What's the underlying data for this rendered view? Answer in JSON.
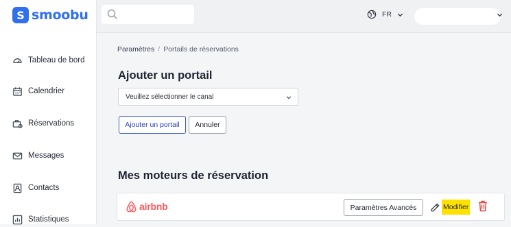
{
  "brand": {
    "name": "smoobu",
    "mark": "S",
    "color": "#2f6ff0"
  },
  "sidebar": {
    "items": [
      {
        "label": "Tableau de bord",
        "icon": "dashboard-icon"
      },
      {
        "label": "Calendrier",
        "icon": "calendar-icon"
      },
      {
        "label": "Réservations",
        "icon": "reservations-icon"
      },
      {
        "label": "Messages",
        "icon": "mail-icon"
      },
      {
        "label": "Contacts",
        "icon": "contacts-icon"
      },
      {
        "label": "Statistiques",
        "icon": "statistics-icon"
      }
    ]
  },
  "topbar": {
    "language": "FR",
    "language_icon": "globe-icon"
  },
  "breadcrumb": {
    "parent": "Paramètres",
    "separator": "/",
    "current": "Portails de réservations"
  },
  "add_portal": {
    "title": "Ajouter un portail",
    "select_value": "Veuillez sélectionner le canal",
    "add_button": "Ajouter un portail",
    "cancel_button": "Annuler"
  },
  "engines": {
    "title": "Mes moteurs de réservation",
    "items": [
      {
        "name": "airbnb",
        "brand_color": "#ff5a5f",
        "advanced_button": "Paramètres Avancés",
        "edit_label": "Modifier"
      }
    ]
  }
}
